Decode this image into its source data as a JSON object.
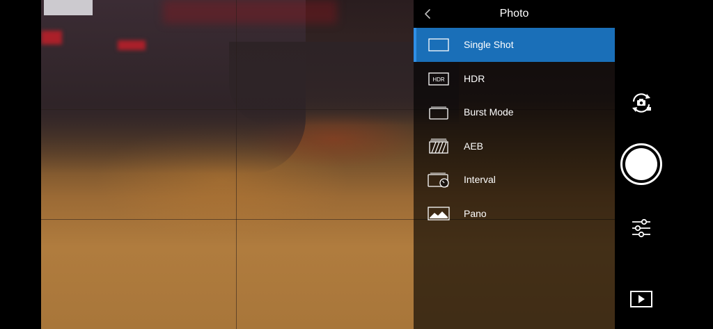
{
  "viewfinder": {
    "grid": "on"
  },
  "photo_menu": {
    "title": "Photo",
    "back_icon": "chevron-left-icon",
    "items": [
      {
        "label": "Single Shot",
        "icon": "single-shot-icon",
        "selected": true
      },
      {
        "label": "HDR",
        "icon": "hdr-icon",
        "icon_text": "HDR",
        "selected": false
      },
      {
        "label": "Burst Mode",
        "icon": "burst-mode-icon",
        "selected": false
      },
      {
        "label": "AEB",
        "icon": "aeb-icon",
        "selected": false
      },
      {
        "label": "Interval",
        "icon": "interval-icon",
        "selected": false
      },
      {
        "label": "Pano",
        "icon": "pano-icon",
        "selected": false
      }
    ]
  },
  "controls": {
    "switch_mode_icon": "camera-switch-icon",
    "shutter_icon": "shutter-icon",
    "settings_icon": "sliders-icon",
    "playback_icon": "playback-icon"
  },
  "colors": {
    "selected_bg": "#1a6fb8",
    "selected_accent": "#2f8fe6",
    "panel_bg": "#000000",
    "text": "#ffffff"
  }
}
